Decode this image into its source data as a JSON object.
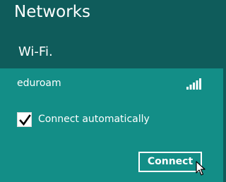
{
  "panel": {
    "title": "Networks",
    "section_heading": "Wi-Fi."
  },
  "network": {
    "name": "eduroam",
    "signal_icon": "signal-strength-icon",
    "signal_bars": 5,
    "auto_connect": {
      "label": "Connect automatically",
      "checked": true
    },
    "connect_label": "Connect"
  },
  "colors": {
    "header_bg": "#0f5c5b",
    "item_bg": "#138e87",
    "text": "#ffffff"
  }
}
